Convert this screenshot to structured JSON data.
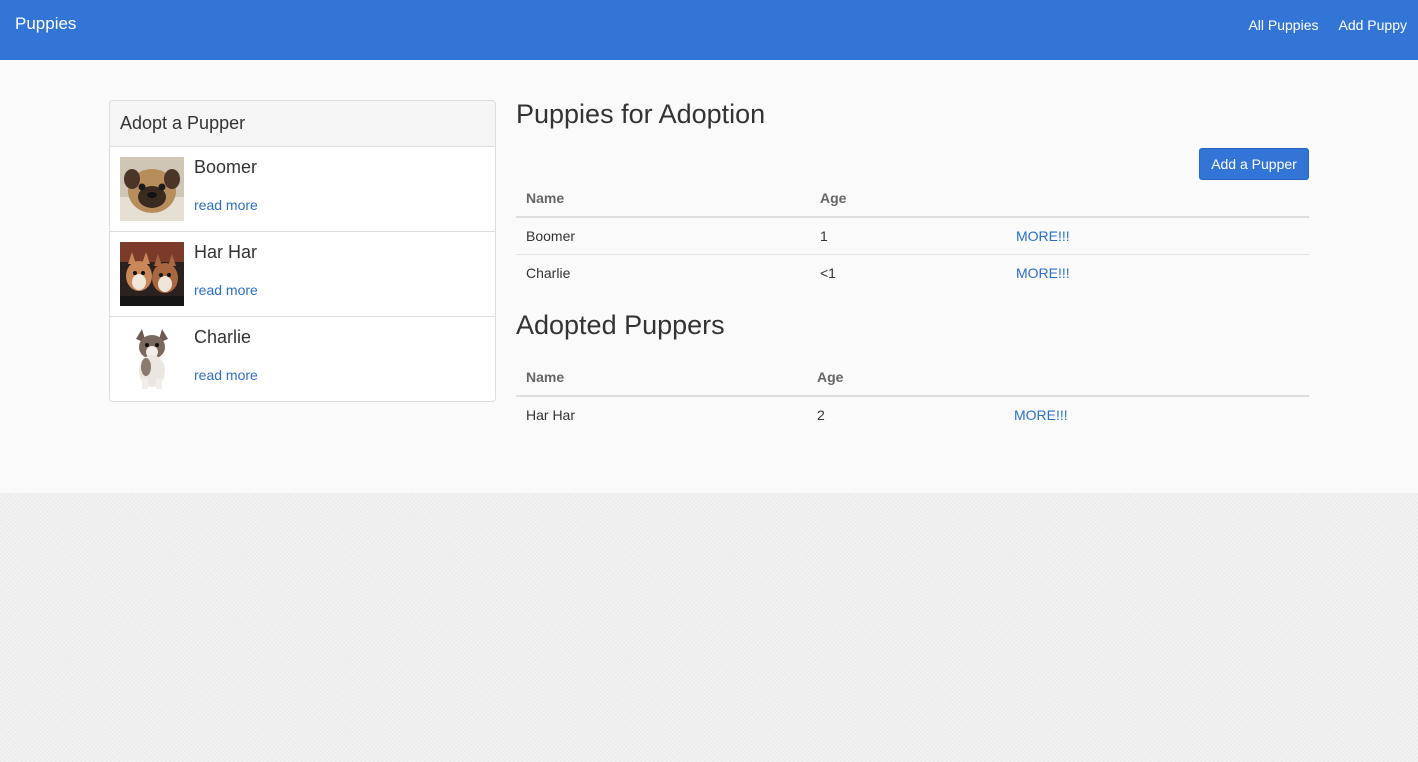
{
  "navbar": {
    "brand": "Puppies",
    "links": [
      "All Puppies",
      "Add Puppy"
    ],
    "color": "#3374d7"
  },
  "sidebar": {
    "title": "Adopt a Pupper",
    "items": [
      {
        "name": "Boomer",
        "link": "read more",
        "icon": "pug-puppy-photo"
      },
      {
        "name": "Har Har",
        "link": "read more",
        "icon": "corgi-puppies-photo"
      },
      {
        "name": "Charlie",
        "link": "read more",
        "icon": "chihuahua-puppy-photo"
      }
    ]
  },
  "adoption": {
    "title": "Puppies for Adoption",
    "add_button": "Add a Pupper",
    "columns": [
      "Name",
      "Age",
      ""
    ],
    "rows": [
      {
        "name": "Boomer",
        "age": "1",
        "link": "MORE!!!"
      },
      {
        "name": "Charlie",
        "age": "<1",
        "link": "MORE!!!"
      }
    ]
  },
  "adopted": {
    "title": "Adopted Puppers",
    "columns": [
      "Name",
      "Age",
      ""
    ],
    "rows": [
      {
        "name": "Har Har",
        "age": "2",
        "link": "MORE!!!"
      }
    ]
  },
  "colors": {
    "accent": "#3374d7",
    "link": "#2b6fc9"
  }
}
